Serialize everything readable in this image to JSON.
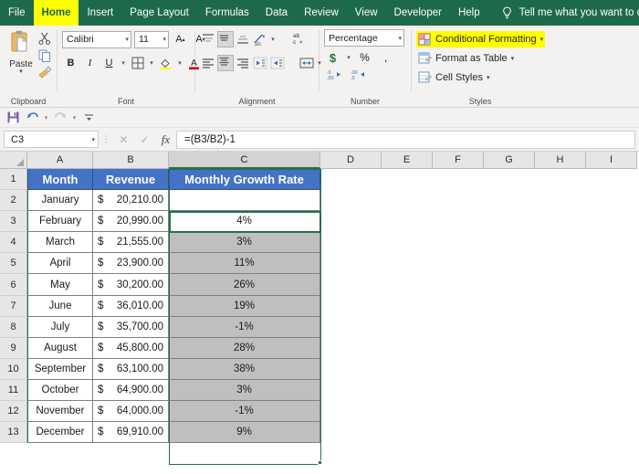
{
  "ribbon": {
    "tabs": [
      {
        "label": "File",
        "active": false
      },
      {
        "label": "Home",
        "active": true
      },
      {
        "label": "Insert",
        "active": false
      },
      {
        "label": "Page Layout",
        "active": false
      },
      {
        "label": "Formulas",
        "active": false
      },
      {
        "label": "Data",
        "active": false
      },
      {
        "label": "Review",
        "active": false
      },
      {
        "label": "View",
        "active": false
      },
      {
        "label": "Developer",
        "active": false
      },
      {
        "label": "Help",
        "active": false
      }
    ],
    "tellme": "Tell me what you want to do",
    "tellme_icon": "lightbulb-icon",
    "groups": {
      "clipboard": {
        "label": "Clipboard",
        "paste": "Paste",
        "items": [
          "paste-icon",
          "cut-scissors-icon",
          "copy-icon",
          "format-painter-icon"
        ]
      },
      "font": {
        "label": "Font",
        "font_name": "Calibri",
        "font_size": "11",
        "bold": "B",
        "italic": "I",
        "underline": "U",
        "icons": [
          "grow-font-icon",
          "shrink-font-icon",
          "borders-icon",
          "fill-color-icon",
          "font-color-icon"
        ]
      },
      "alignment": {
        "label": "Alignment",
        "icons": [
          "align-left-icon",
          "align-center-icon",
          "align-right-icon",
          "orientation-icon",
          "wrap-text-icon",
          "top-align-icon",
          "middle-align-icon",
          "bottom-align-icon",
          "decrease-indent-icon",
          "increase-indent-icon",
          "merge-center-icon"
        ]
      },
      "number": {
        "label": "Number",
        "format": "Percentage",
        "currency": "$",
        "percent": "%",
        "comma": ",",
        "icons": [
          "increase-decimal-icon",
          "decrease-decimal-icon"
        ]
      },
      "styles": {
        "label": "Styles",
        "items": [
          {
            "label": "Conditional Formatting",
            "icon": "conditional-formatting-icon",
            "highlight": true
          },
          {
            "label": "Format as Table",
            "icon": "format-as-table-icon",
            "highlight": false
          },
          {
            "label": "Cell Styles",
            "icon": "cell-styles-icon",
            "highlight": false
          }
        ]
      }
    }
  },
  "qat": {
    "items": [
      "save-icon",
      "undo-icon",
      "redo-icon",
      "customize-qat-icon"
    ]
  },
  "formula_bar": {
    "name_box": "C3",
    "cancel_icon": "cancel-x-icon",
    "enter_icon": "enter-check-icon",
    "function_icon": "insert-function-fx-icon",
    "formula": "=(B3/B2)-1"
  },
  "sheet": {
    "columns": [
      "A",
      "B",
      "C",
      "D",
      "E",
      "F",
      "G",
      "H",
      "I"
    ],
    "selected_column": "C",
    "rows": [
      "1",
      "2",
      "3",
      "4",
      "5",
      "6",
      "7",
      "8",
      "9",
      "10",
      "11",
      "12",
      "13"
    ],
    "headers": {
      "month": "Month",
      "revenue": "Revenue",
      "growth": "Monthly Growth Rate"
    },
    "data": [
      {
        "row": "2",
        "month": "January",
        "revenue_symbol": "$",
        "revenue": "20,210.00",
        "growth": "",
        "shaded": false
      },
      {
        "row": "3",
        "month": "February",
        "revenue_symbol": "$",
        "revenue": "20,990.00",
        "growth": "4%",
        "shaded": false
      },
      {
        "row": "4",
        "month": "March",
        "revenue_symbol": "$",
        "revenue": "21,555.00",
        "growth": "3%",
        "shaded": true
      },
      {
        "row": "5",
        "month": "April",
        "revenue_symbol": "$",
        "revenue": "23,900.00",
        "growth": "11%",
        "shaded": true
      },
      {
        "row": "6",
        "month": "May",
        "revenue_symbol": "$",
        "revenue": "30,200.00",
        "growth": "26%",
        "shaded": true
      },
      {
        "row": "7",
        "month": "June",
        "revenue_symbol": "$",
        "revenue": "36,010.00",
        "growth": "19%",
        "shaded": true
      },
      {
        "row": "8",
        "month": "July",
        "revenue_symbol": "$",
        "revenue": "35,700.00",
        "growth": "-1%",
        "shaded": true
      },
      {
        "row": "9",
        "month": "August",
        "revenue_symbol": "$",
        "revenue": "45,800.00",
        "growth": "28%",
        "shaded": true
      },
      {
        "row": "10",
        "month": "September",
        "revenue_symbol": "$",
        "revenue": "63,100.00",
        "growth": "38%",
        "shaded": true
      },
      {
        "row": "11",
        "month": "October",
        "revenue_symbol": "$",
        "revenue": "64,900.00",
        "growth": "3%",
        "shaded": true
      },
      {
        "row": "12",
        "month": "November",
        "revenue_symbol": "$",
        "revenue": "64,000.00",
        "growth": "-1%",
        "shaded": true
      },
      {
        "row": "13",
        "month": "December",
        "revenue_symbol": "$",
        "revenue": "69,910.00",
        "growth": "9%",
        "shaded": true
      }
    ],
    "active_cell": "C3"
  },
  "colors": {
    "ribbon_green": "#1D6A4B",
    "accent_green": "#217346",
    "header_blue": "#4472C4",
    "highlight_yellow": "#FFFF00",
    "shaded_gray": "#BFBFBF"
  }
}
